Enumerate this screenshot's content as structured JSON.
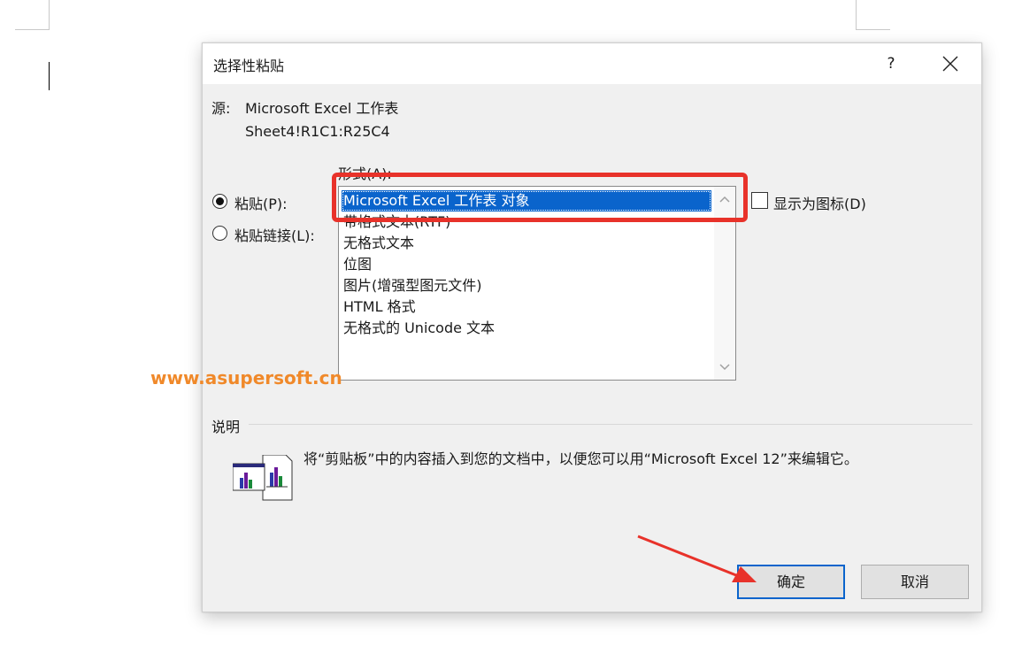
{
  "dialog": {
    "title": "选择性粘贴",
    "help_label": "?",
    "source_label": "源:",
    "source_name": "Microsoft Excel 工作表",
    "source_range": "Sheet4!R1C1:R25C4",
    "format_label": "形式(A):",
    "paste_label": "粘贴(P):",
    "paste_link_label": "粘贴链接(L):",
    "paste_selected": true,
    "formats": [
      "Microsoft Excel 工作表 对象",
      "带格式文本(RTF)",
      "无格式文本",
      "位图",
      "图片(增强型图元文件)",
      "HTML 格式",
      "无格式的 Unicode 文本"
    ],
    "selected_format_index": 0,
    "display_as_icon_label": "显示为图标(D)",
    "display_as_icon_checked": false,
    "description_label": "说明",
    "description_text": "将“剪贴板”中的内容插入到您的文档中，以便您可以用“Microsoft Excel 12”来编辑它。",
    "ok_label": "确定",
    "cancel_label": "取消"
  },
  "watermark": "www.asupersoft.cn",
  "colors": {
    "selection": "#0a64cc",
    "annotation": "#e8322a",
    "watermark": "#f0892a"
  }
}
